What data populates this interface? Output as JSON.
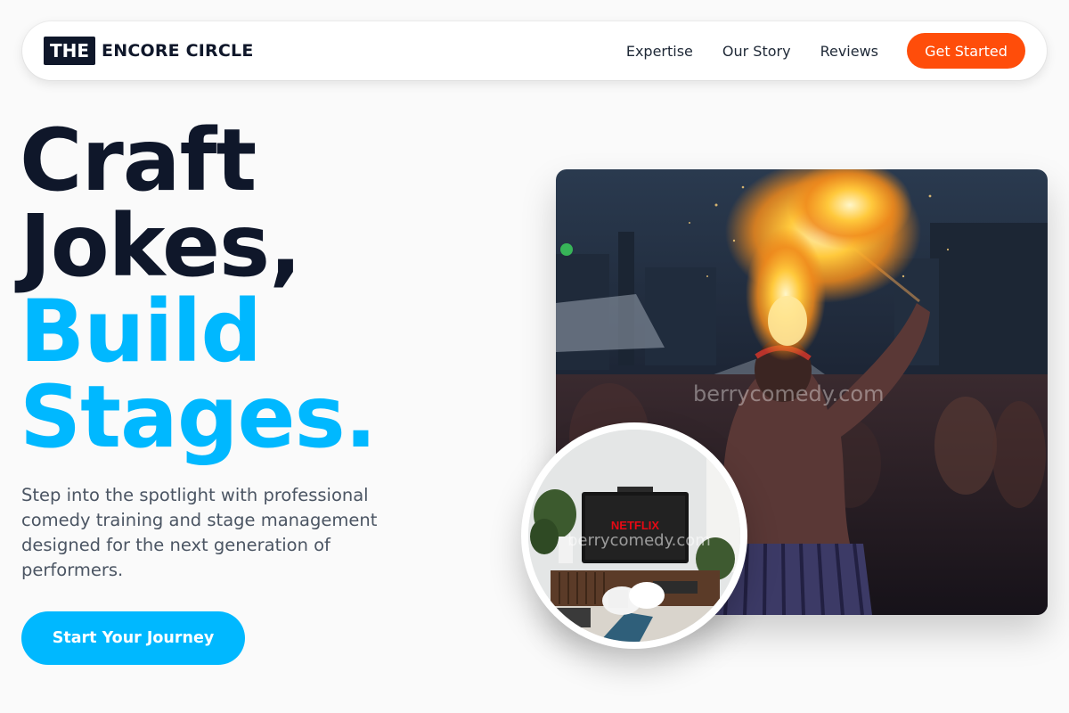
{
  "nav": {
    "brand_box": "THE",
    "brand_name": "ENCORE CIRCLE",
    "links": [
      "Expertise",
      "Our Story",
      "Reviews"
    ],
    "cta_label": "Get Started"
  },
  "hero": {
    "title_lines": [
      "Craft",
      "Jokes,",
      "Build",
      "Stages."
    ],
    "subtitle": "Step into the spotlight with professional comedy training and stage management designed for the next generation of performers.",
    "button_label": "Start Your Journey"
  },
  "images": {
    "main_watermark": "berrycomedy.com",
    "circle_watermark": "berrycomedy.com",
    "tv_brand": "NETFLIX"
  },
  "colors": {
    "dark": "#0f172a",
    "accent_blue": "#00b8ff",
    "accent_orange": "#ff4d0a"
  }
}
